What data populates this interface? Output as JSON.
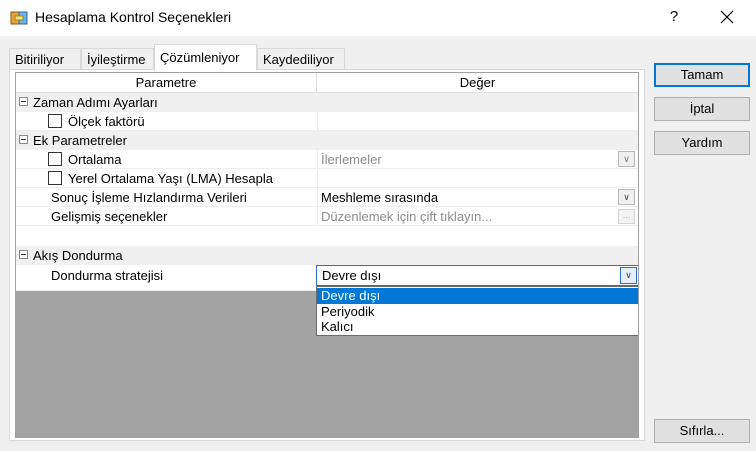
{
  "window": {
    "title": "Hesaplama Kontrol Seçenekleri",
    "help_glyph": "?",
    "close_glyph": "✕",
    "app_icon": "calculator-app-icon"
  },
  "tabs": [
    {
      "label": "Bitiriliyor",
      "active": false
    },
    {
      "label": "İyileştirme",
      "active": false
    },
    {
      "label": "Çözümleniyor",
      "active": true
    },
    {
      "label": "Kaydediliyor",
      "active": false
    }
  ],
  "grid": {
    "headers": {
      "parameter": "Parametre",
      "value": "Değer"
    },
    "categories": {
      "time_step": "Zaman Adımı Ayarları",
      "extra": "Ek Parametreler",
      "flow_freeze": "Akış Dondurma"
    },
    "props": {
      "scale_factor": {
        "label": "Ölçek faktörü",
        "value": ""
      },
      "averaging": {
        "label": "Ortalama",
        "value": "İlerlemeler"
      },
      "lma": {
        "label": "Yerel Ortalama Yaşı (LMA) Hesapla",
        "value": ""
      },
      "accel_data": {
        "label": "Sonuç İşleme Hızlandırma Verileri",
        "value": "Meshleme sırasında"
      },
      "advanced": {
        "label": "Gelişmiş seçenekler",
        "value": "Düzenlemek için çift tıklayın..."
      },
      "freeze_strategy": {
        "label": "Dondurma stratejisi",
        "value": "Devre dışı"
      }
    },
    "dropdown_options": [
      "Devre dışı",
      "Periyodik",
      "Kalıcı"
    ],
    "dropdown_glyph": "∨",
    "ellipsis_glyph": "..."
  },
  "buttons": {
    "ok": "Tamam",
    "cancel": "İptal",
    "help": "Yardım",
    "reset": "Sıfırla..."
  },
  "colors": {
    "selection": "#0078d7",
    "grid_empty": "#a3a3a3"
  }
}
